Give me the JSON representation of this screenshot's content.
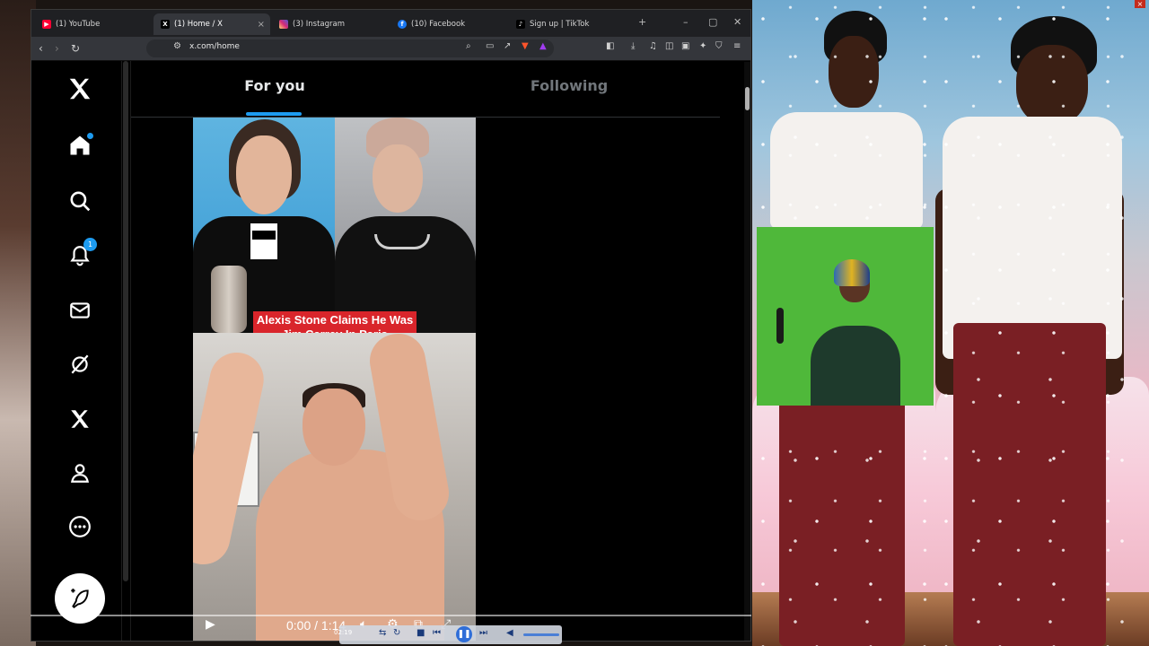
{
  "browser": {
    "tabs": [
      {
        "label": "(1) YouTube",
        "favicon": "youtube-icon",
        "color": "#ff0033",
        "active": false
      },
      {
        "label": "(1) Home / X",
        "favicon": "x-logo-icon",
        "color": "#000000",
        "active": true
      },
      {
        "label": "(3) Instagram",
        "favicon": "instagram-icon",
        "color": "#d62976",
        "active": false
      },
      {
        "label": "(10) Facebook",
        "favicon": "facebook-icon",
        "color": "#1877f2",
        "active": false
      },
      {
        "label": "Sign up | TikTok",
        "favicon": "tiktok-icon",
        "color": "#000000",
        "active": false
      }
    ],
    "new_tab_label": "+",
    "url": "x.com/home"
  },
  "x": {
    "feed_tabs": [
      {
        "label": "For you",
        "active": true
      },
      {
        "label": "Following",
        "active": false
      }
    ],
    "nav": [
      {
        "name": "x-logo-icon"
      },
      {
        "name": "home-icon",
        "badge": "dot"
      },
      {
        "name": "search-icon"
      },
      {
        "name": "notifications-icon",
        "badge": "1"
      },
      {
        "name": "messages-icon"
      },
      {
        "name": "grok-icon"
      },
      {
        "name": "premium-icon"
      },
      {
        "name": "profile-icon"
      },
      {
        "name": "more-icon"
      }
    ],
    "notification_count": "1",
    "accent": "#1d9bf0"
  },
  "video": {
    "caption": "Alexis Stone Claims He Was Jim Carrey In Paris",
    "time": "0:00 / 1:14"
  },
  "media_player": {
    "elapsed": "02:19"
  }
}
